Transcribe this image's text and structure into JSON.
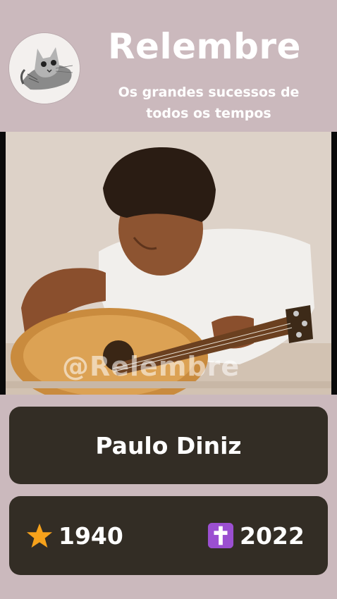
{
  "header": {
    "title": "Relembre",
    "subtitle": "Os grandes sucessos de todos os tempos"
  },
  "photo": {
    "watermark": "@Relembre"
  },
  "artist": {
    "name": "Paulo Diniz"
  },
  "dates": {
    "birth_year": "1940",
    "death_year": "2022",
    "birth_icon": "star-icon",
    "death_icon": "cross-icon"
  },
  "colors": {
    "background": "#cbb9bd",
    "card": "#332d25",
    "star": "#f7a21b",
    "cross_bg": "#9b4fd1",
    "text": "#ffffff"
  }
}
